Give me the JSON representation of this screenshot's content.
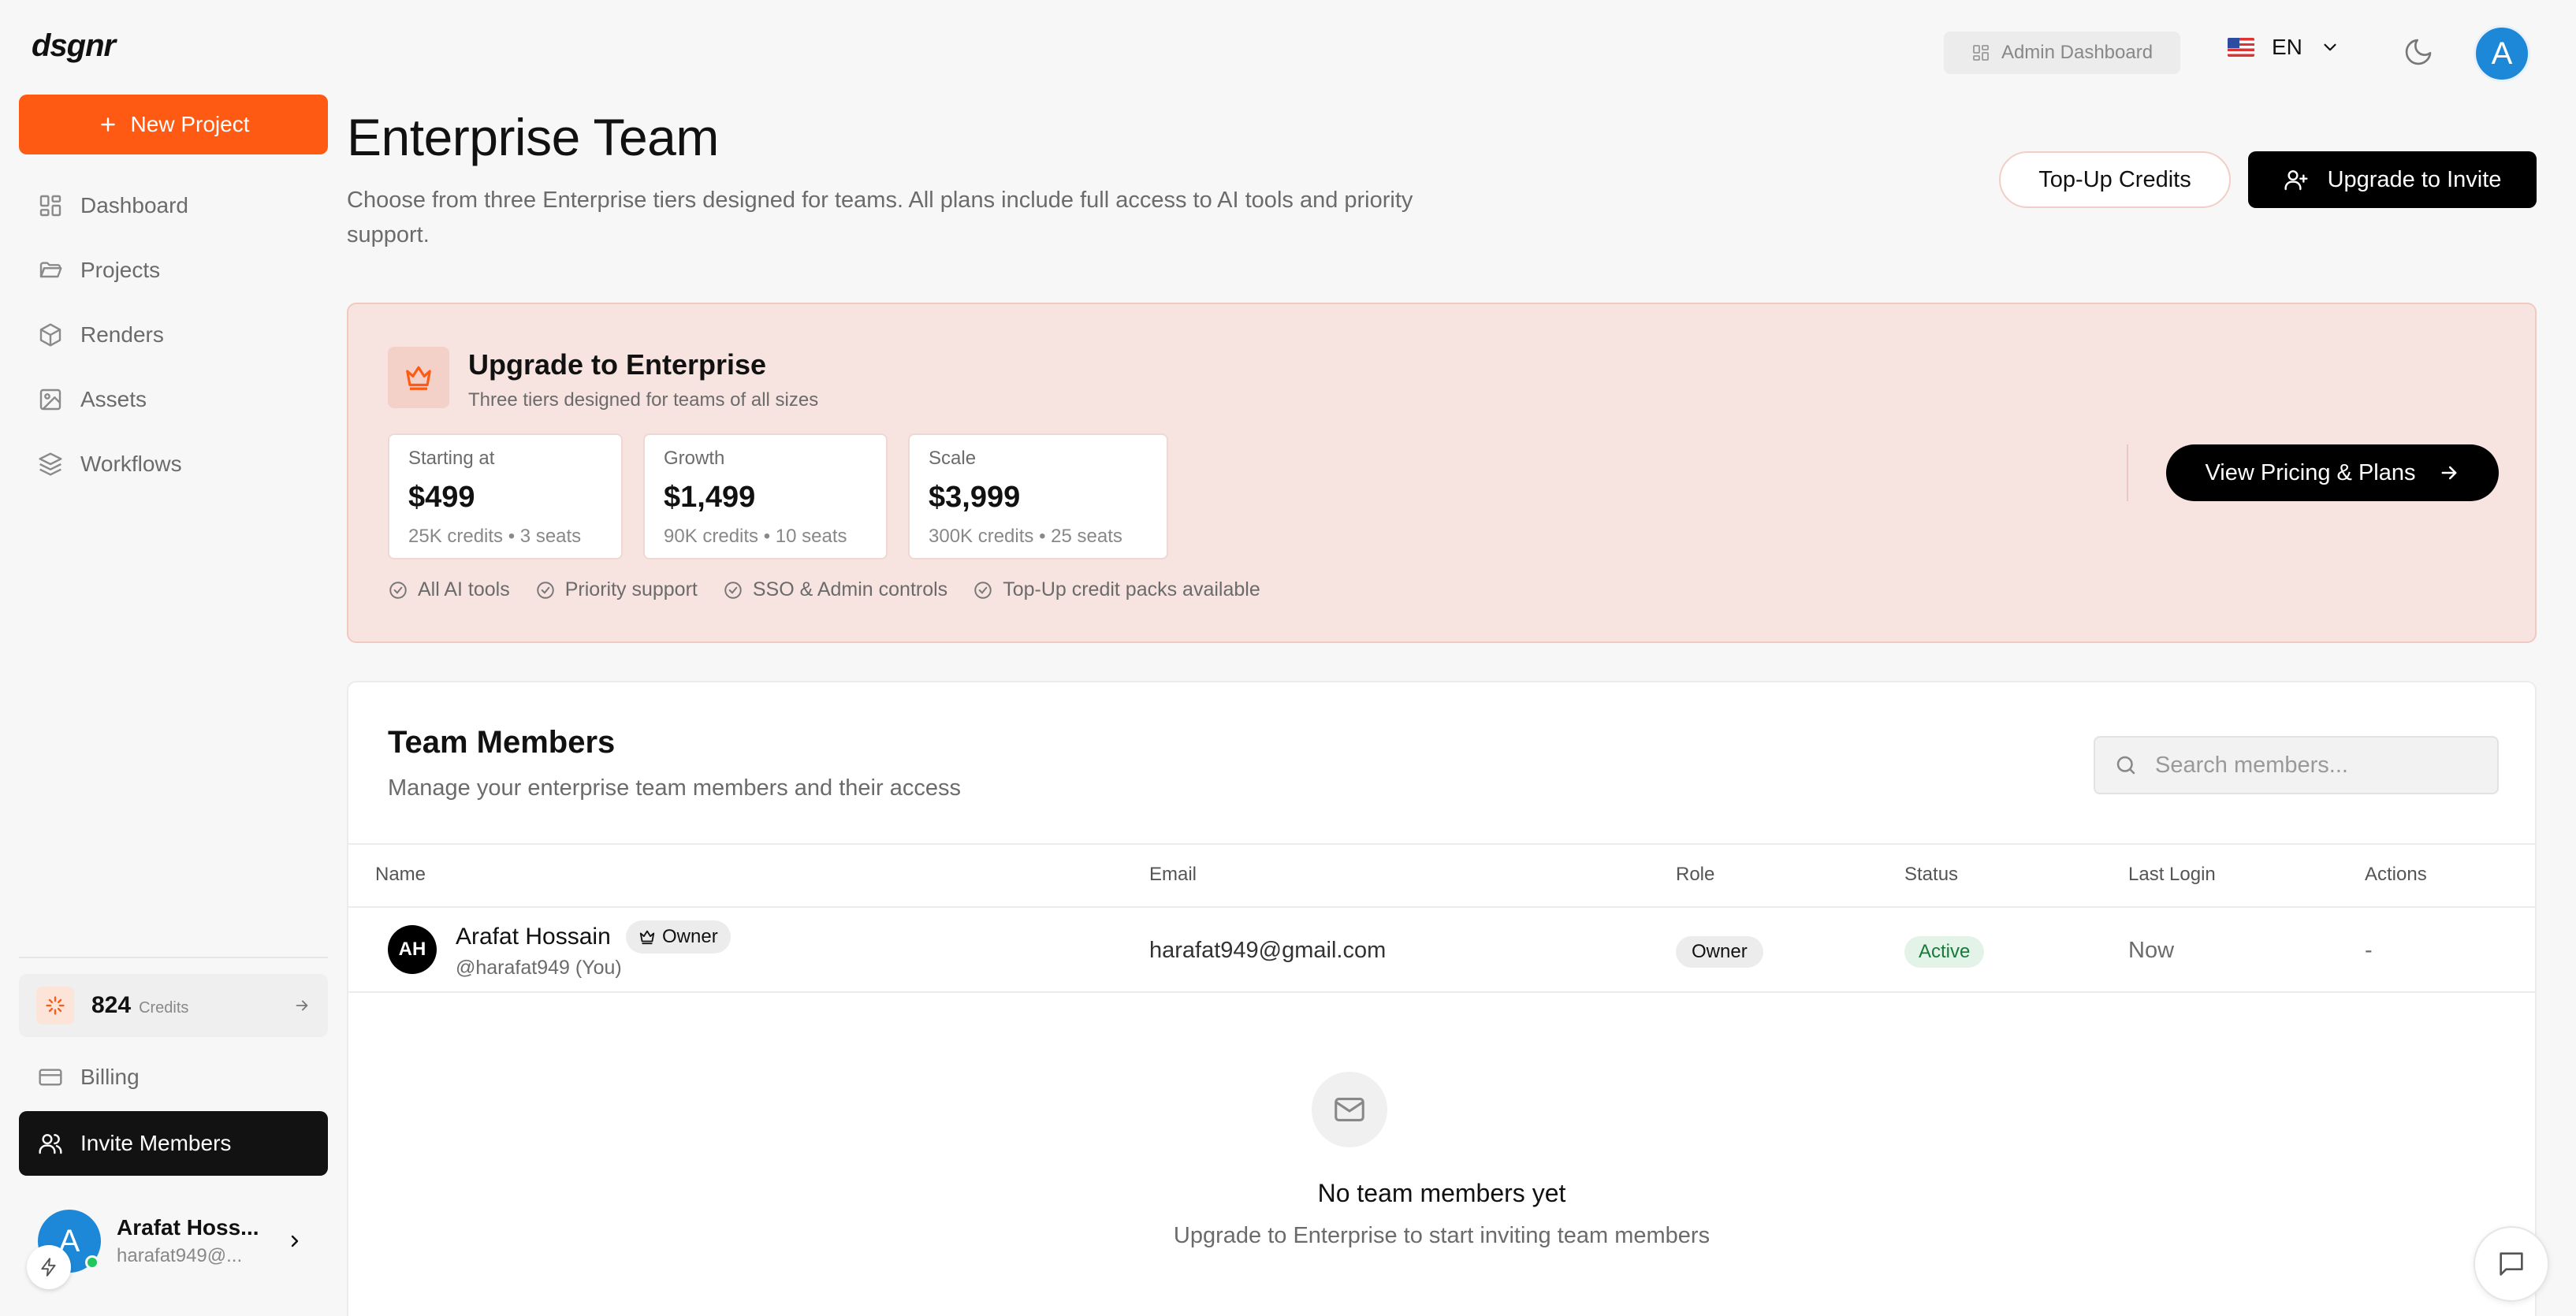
{
  "app": {
    "logo": "dsgnr"
  },
  "sidebar": {
    "new_project_label": "New Project",
    "items": [
      {
        "label": "Dashboard",
        "icon": "grid-icon"
      },
      {
        "label": "Projects",
        "icon": "folder-icon"
      },
      {
        "label": "Renders",
        "icon": "cube-icon"
      },
      {
        "label": "Assets",
        "icon": "image-icon"
      },
      {
        "label": "Workflows",
        "icon": "layers-icon"
      }
    ],
    "credits": {
      "value": "824",
      "label": "Credits"
    },
    "billing_label": "Billing",
    "invite_label": "Invite Members",
    "user": {
      "initial": "A",
      "name": "Arafat Hoss...",
      "email": "harafat949@..."
    }
  },
  "topbar": {
    "admin_label": "Admin Dashboard",
    "language": "EN",
    "avatar_initial": "A"
  },
  "header": {
    "title": "Enterprise Team",
    "subtitle": "Choose from three Enterprise tiers designed for teams. All plans include full access to AI tools and priority support.",
    "topup_label": "Top-Up Credits",
    "upgrade_label": "Upgrade to Invite"
  },
  "banner": {
    "title": "Upgrade to Enterprise",
    "subtitle": "Three tiers designed for teams of all sizes",
    "tiers": [
      {
        "label": "Starting at",
        "price": "$499",
        "detail": "25K credits • 3 seats"
      },
      {
        "label": "Growth",
        "price": "$1,499",
        "detail": "90K credits • 10 seats"
      },
      {
        "label": "Scale",
        "price": "$3,999",
        "detail": "300K credits • 25 seats"
      }
    ],
    "features": [
      "All AI tools",
      "Priority support",
      "SSO & Admin controls",
      "Top-Up credit packs available"
    ],
    "cta_label": "View Pricing & Plans",
    "accent": "#ff5a14"
  },
  "team": {
    "title": "Team Members",
    "subtitle": "Manage your enterprise team members and their access",
    "search_placeholder": "Search members...",
    "columns": [
      "Name",
      "Email",
      "Role",
      "Status",
      "Last Login",
      "Actions"
    ],
    "rows": [
      {
        "initials": "AH",
        "name": "Arafat Hossain",
        "badge": "Owner",
        "handle": "@harafat949 (You)",
        "email": "harafat949@gmail.com",
        "role": "Owner",
        "status": "Active",
        "last_login": "Now",
        "actions": "-"
      }
    ],
    "empty_title": "No team members yet",
    "empty_subtitle": "Upgrade to Enterprise to start inviting team members"
  }
}
